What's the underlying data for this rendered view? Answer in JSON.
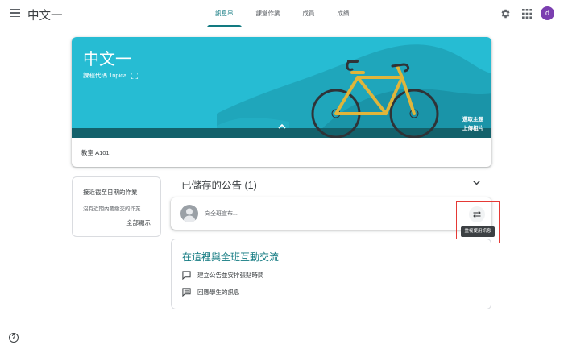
{
  "header": {
    "app_title": "中文一",
    "tabs": [
      {
        "label": "訊息串",
        "active": true
      },
      {
        "label": "課堂作業",
        "active": false
      },
      {
        "label": "成員",
        "active": false
      },
      {
        "label": "成績",
        "active": false
      }
    ],
    "avatar_letter": "d",
    "icons": [
      "menu-icon",
      "gear-icon",
      "apps-grid-icon"
    ]
  },
  "banner": {
    "course_name": "中文一",
    "class_code": "課程代碼  1npica",
    "select_theme": "選取主題",
    "upload_photo": "上傳相片",
    "room": "教室 A101",
    "color": "#26bcd3"
  },
  "upcoming": {
    "title": "接近截至日期的作業",
    "empty_text": "沒有近期內要繳交的作業",
    "view_all": "全部顯示"
  },
  "stream": {
    "saved_announcements": "已儲存的公告 (1)",
    "compose_placeholder": "向全班宣布...",
    "reuse_tooltip": "重複使用訊息"
  },
  "engage": {
    "title": "在這裡與全班互動交流",
    "items": [
      {
        "label": "建立公告並安排張貼時間",
        "icon": "announcement-icon"
      },
      {
        "label": "回應學生的訊息",
        "icon": "message-icon"
      }
    ],
    "accent": "#127a81"
  }
}
